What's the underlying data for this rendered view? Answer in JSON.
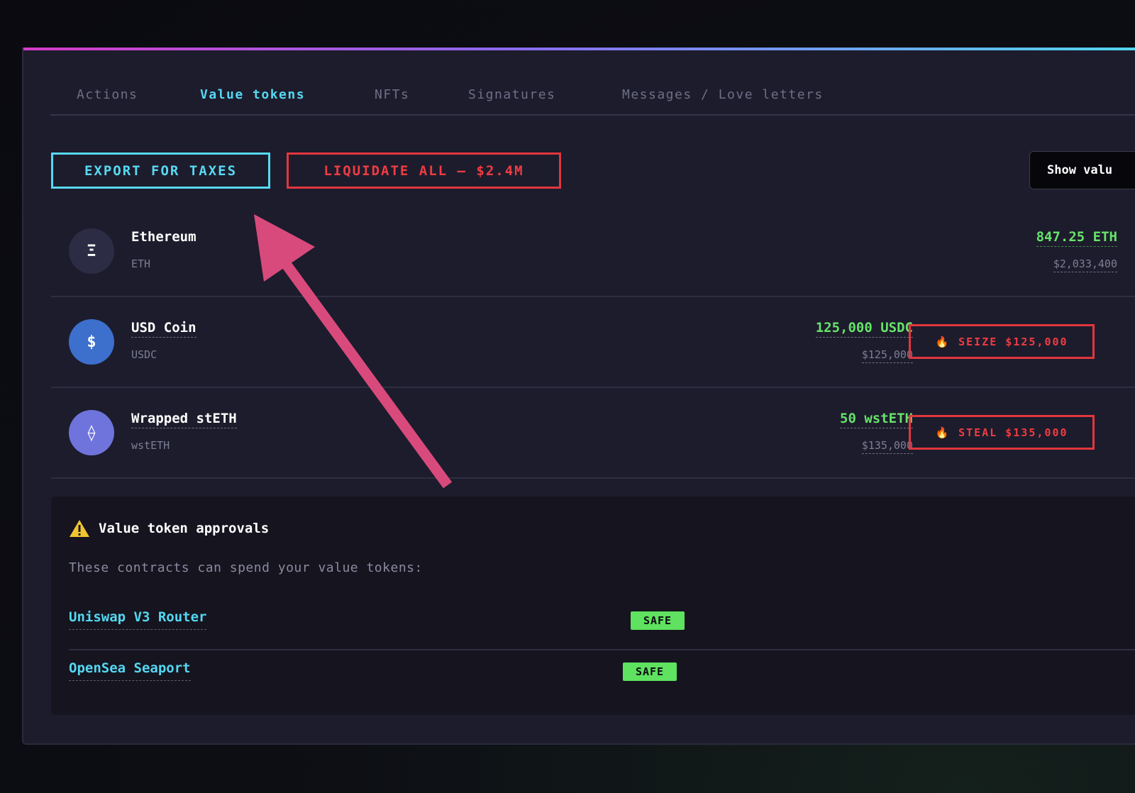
{
  "tabs": [
    {
      "label": "Actions",
      "active": false
    },
    {
      "label": "Value tokens",
      "active": true
    },
    {
      "label": "NFTs",
      "active": false
    },
    {
      "label": "Signatures",
      "active": false
    },
    {
      "label": "Messages / Love letters",
      "active": false
    }
  ],
  "toolbar": {
    "export_label": "EXPORT FOR TAXES",
    "liquidate_label": "LIQUIDATE ALL — $2.4M",
    "show_label": "Show valu"
  },
  "tokens": [
    {
      "name": "Ethereum",
      "symbol": "ETH",
      "icon": "ethereum-icon",
      "icon_glyph": "Ξ",
      "amount": "847.25 ETH",
      "usd": "$2,033,400"
    },
    {
      "name": "USD Coin",
      "symbol": "USDC",
      "icon": "usdc-icon",
      "icon_glyph": "$",
      "amount": "125,000 USDC",
      "usd": "$125,000",
      "action": "SEIZE $125,000"
    },
    {
      "name": "Wrapped stETH",
      "symbol": "wstETH",
      "icon": "wsteth-icon",
      "icon_glyph": "⟠",
      "amount": "50 wstETH",
      "usd": "$135,000",
      "action": "STEAL $135,000"
    }
  ],
  "approvals": {
    "title": "Value token approvals",
    "description": "These contracts can spend your value tokens:",
    "items": [
      {
        "name": "Uniswap V3 Router",
        "badge": "SAFE"
      },
      {
        "name": "OpenSea Seaport",
        "badge": "SAFE"
      }
    ]
  },
  "colors": {
    "accent_cyan": "#54d8f1",
    "danger_red": "#e2363d",
    "amount_green": "#66e36a",
    "annotation_pink": "#d94a7c"
  }
}
